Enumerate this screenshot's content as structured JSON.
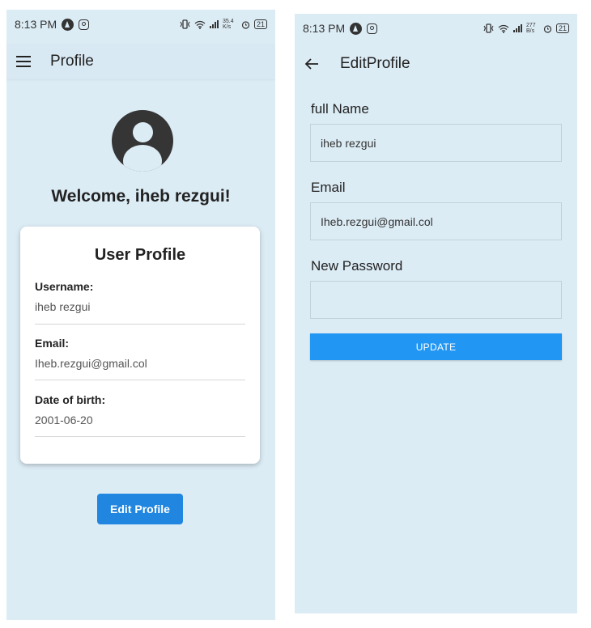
{
  "status_bar": {
    "time_left": "8:13 PM",
    "time_right": "8:13 PM",
    "net_speed_left": "35.4 K/s",
    "net_speed_right": "277 B/s",
    "battery": "21"
  },
  "profile_screen": {
    "app_bar": {
      "title": "Profile",
      "menu_icon": "menu-icon"
    },
    "avatar_icon": "account-circle-icon",
    "welcome": "Welcome, iheb rezgui!",
    "card": {
      "title": "User Profile",
      "fields": [
        {
          "label": "Username:",
          "value": "iheb rezgui"
        },
        {
          "label": "Email:",
          "value": "Iheb.rezgui@gmail.col"
        },
        {
          "label": "Date of birth:",
          "value": "2001-06-20"
        }
      ]
    },
    "edit_button": "Edit Profile"
  },
  "edit_screen": {
    "app_bar": {
      "title": "EditProfile",
      "back_icon": "arrow-back-icon"
    },
    "form": {
      "full_name_label": "full Name",
      "full_name_value": "iheb rezgui",
      "email_label": "Email",
      "email_value": "Iheb.rezgui@gmail.col",
      "password_label": "New Password",
      "password_value": ""
    },
    "update_button": "UPDATE"
  },
  "colors": {
    "background": "#dcecf5",
    "primary_button": "#2086e0",
    "update_button": "#2196f3",
    "avatar": "#353535"
  }
}
